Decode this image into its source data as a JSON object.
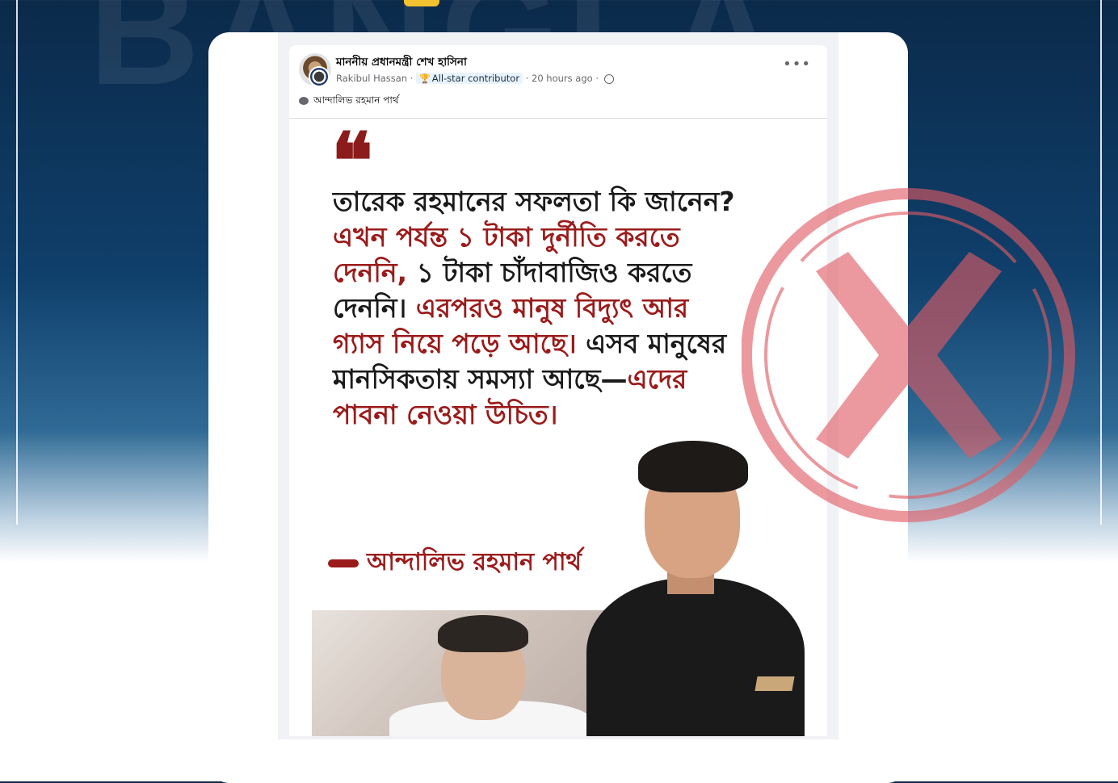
{
  "background": {
    "watermark": "BANGLA",
    "colors": {
      "navy": "#0b2a4a",
      "stamp_red": "#e05b63",
      "quote_red": "#9b1b1b"
    }
  },
  "post": {
    "group_name": "মাননীয় প্রধানমন্ত্রী শেখ হাসিনা",
    "author": "Rakibul Hassan",
    "badge": "All-star contributor",
    "time": "20 hours ago",
    "tag": "আন্দালিভ রহমান পার্থ",
    "icons": {
      "avatar": "avatar",
      "more": "more-icon",
      "trophy": "trophy-icon",
      "globe": "globe-icon",
      "tag": "chat-icon"
    }
  },
  "quote_card": {
    "quote_mark": "❝",
    "text_1": "তারেক রহমানের সফলতা কি জানেন? ",
    "text_2": "এখন পর্যন্ত ১ টাকা দুর্নীতি করতে দেননি, ",
    "text_3": "১ টাকা চাঁদাবাজিও করতে দেননি। ",
    "text_4": "এরপরও মানুষ বিদ্যুৎ আর গ্যাস নিয়ে পড়ে আছে। ",
    "text_5": "এসব মানুষের মানসিকতায় সমস্যা আছে—",
    "text_6": "এদের পাবনা নেওয়া উচিত।",
    "attribution": "আন্দালিভ রহমান পার্থ"
  },
  "verdict": {
    "stamp": "false-cross-stamp"
  }
}
